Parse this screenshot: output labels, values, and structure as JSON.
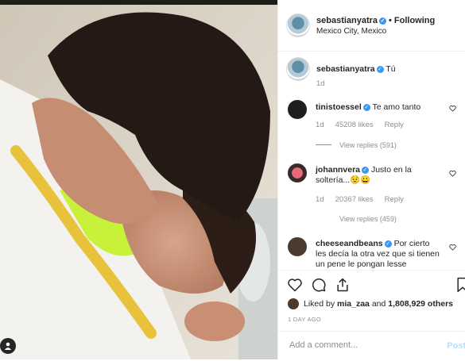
{
  "post": {
    "author": "sebastianyatra",
    "location": "Mexico City, Mexico",
    "following_label": "Following",
    "dot": "•",
    "verified_glyph": "✓"
  },
  "comments": [
    {
      "user": "sebastianyatra",
      "text": "Tú",
      "time": "1d",
      "verified": true
    },
    {
      "user": "tinistoessel",
      "text": "Te amo tanto",
      "time": "1d",
      "likes": "45208 likes",
      "reply": "Reply",
      "view_replies": "View replies (591)"
    },
    {
      "user": "johannvera",
      "text": "Justo en la soltería...😟😀",
      "time": "1d",
      "likes": "20367 likes",
      "reply": "Reply",
      "view_replies": "View replies (459)"
    },
    {
      "user": "cheeseandbeans",
      "text": "Por cierto les decía la otra vez que si tienen un pene le pongan lesse"
    }
  ],
  "actions": {
    "liked_prefix": "Liked by",
    "liked_user": "mia_zaa",
    "liked_and": "and",
    "liked_count": "1,808,929 others",
    "date": "1 DAY AGO",
    "comment_placeholder": "Add a comment...",
    "post_label": "Post"
  },
  "colors": {
    "verified": "#3897f0",
    "muted": "#8e8e8e",
    "post_disabled": "#b2dffc"
  }
}
